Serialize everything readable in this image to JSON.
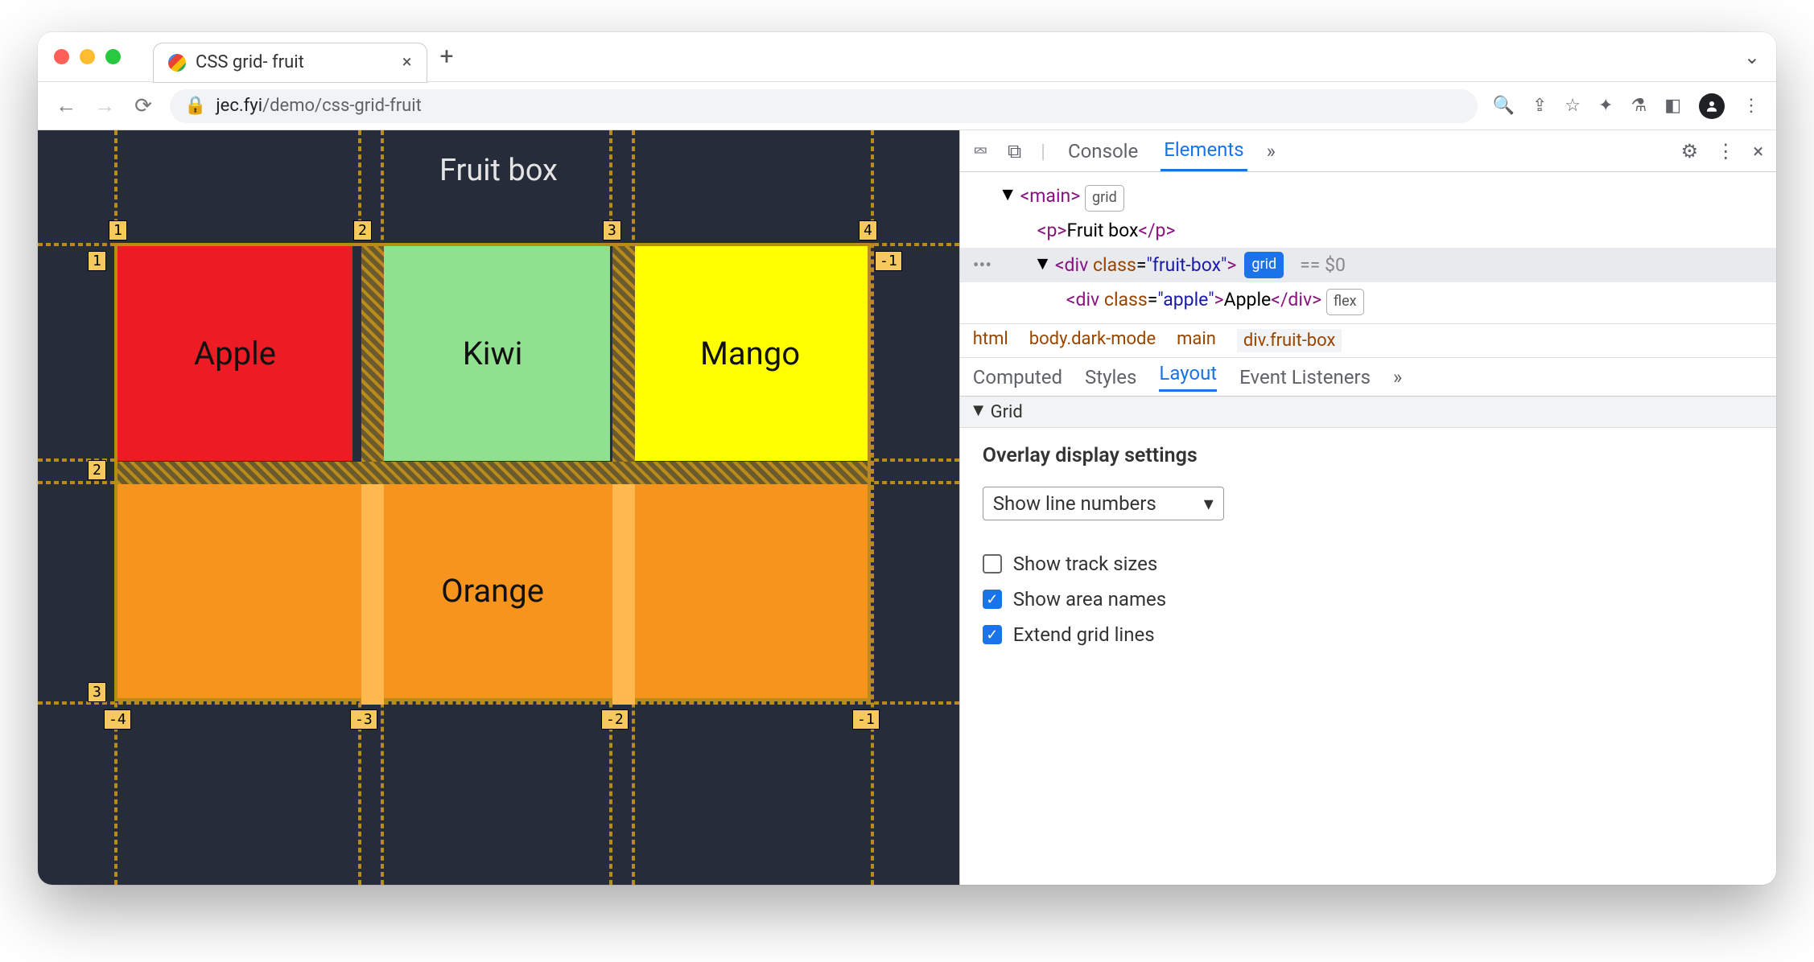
{
  "browser": {
    "tab_title": "CSS grid- fruit",
    "url_domain": "jec.fyi",
    "url_path": "/demo/css-grid-fruit"
  },
  "page": {
    "heading": "Fruit box",
    "cells": {
      "apple": "Apple",
      "kiwi": "Kiwi",
      "mango": "Mango",
      "orange": "Orange"
    },
    "line_labels": {
      "top": [
        "1",
        "2",
        "3",
        "4"
      ],
      "left": [
        "1",
        "2",
        "3"
      ],
      "right_neg": "-1",
      "bottom": [
        "-4",
        "-3",
        "-2",
        "-1"
      ]
    }
  },
  "devtools": {
    "tabs": {
      "console": "Console",
      "elements": "Elements"
    },
    "dom": {
      "main_tag": "main",
      "grid_badge": "grid",
      "p_text": "Fruit box",
      "div_class": "fruit-box",
      "grid_badge2": "grid",
      "eq0": "== $0",
      "child_class": "apple",
      "child_text": "Apple",
      "flex_badge": "flex"
    },
    "crumbs": {
      "html": "html",
      "body": "body.dark-mode",
      "main": "main",
      "fruit": "div.fruit-box"
    },
    "subtabs": {
      "computed": "Computed",
      "styles": "Styles",
      "layout": "Layout",
      "event": "Event Listeners"
    },
    "grid_section": "Grid",
    "overlay": {
      "title": "Overlay display settings",
      "select": "Show line numbers",
      "track_sizes": "Show track sizes",
      "area_names": "Show area names",
      "extend_lines": "Extend grid lines"
    }
  }
}
